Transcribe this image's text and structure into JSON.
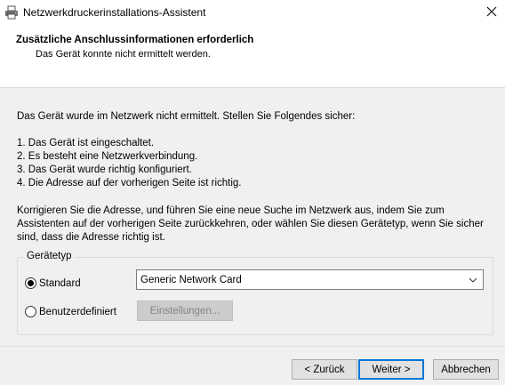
{
  "window": {
    "title": "Netzwerkdruckerinstallations-Assistent",
    "icon": "printer-icon",
    "close_icon": "close-icon"
  },
  "header": {
    "title": "Zusätzliche Anschlussinformationen erforderlich",
    "subtitle": "Das Gerät konnte nicht ermittelt werden."
  },
  "content": {
    "intro": "Das Gerät wurde im Netzwerk nicht ermittelt. Stellen Sie Folgendes sicher:",
    "steps": [
      "1.  Das Gerät ist eingeschaltet.",
      "2.  Es besteht eine Netzwerkverbindung.",
      "3.  Das Gerät wurde richtig konfiguriert.",
      "4.  Die Adresse auf der vorherigen Seite ist richtig."
    ],
    "note": "Korrigieren Sie die Adresse, und führen Sie eine neue Suche im Netzwerk aus, indem Sie zum Assistenten auf der vorherigen Seite zurückkehren, oder wählen Sie diesen Gerätetyp, wenn Sie sicher sind, dass die Adresse richtig ist."
  },
  "device_type": {
    "legend": "Gerätetyp",
    "standard_label": "Standard",
    "standard_selected": true,
    "standard_value": "Generic Network Card",
    "custom_label": "Benutzerdefiniert",
    "custom_selected": false,
    "settings_label": "Einstellungen...",
    "settings_enabled": false
  },
  "buttons": {
    "back": "< Zurück",
    "next": "Weiter >",
    "cancel": "Abbrechen"
  },
  "colors": {
    "accent": "#0078d7",
    "dialog_bg": "#f0f0f0",
    "header_bg": "#ffffff"
  }
}
